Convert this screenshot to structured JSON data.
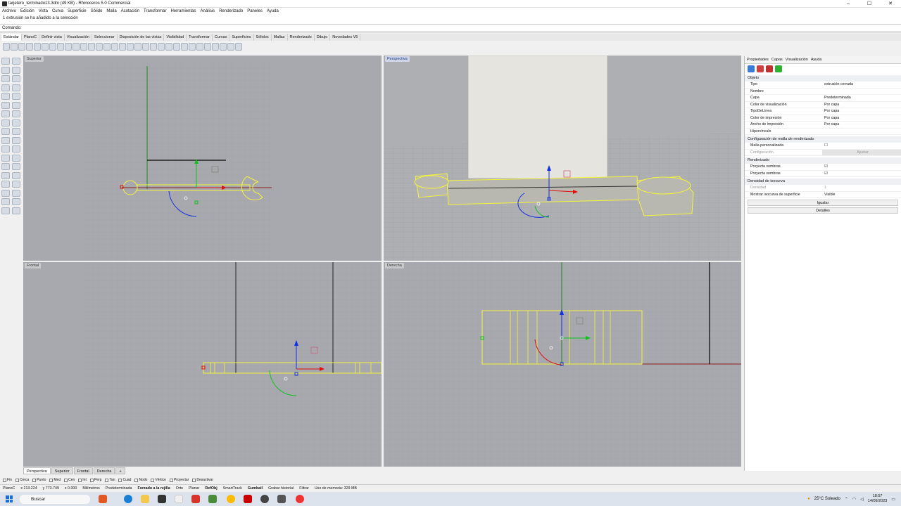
{
  "window": {
    "title": "tarjetero_terminado13.3dm (49 KB) - Rhinoceros 5.0 Commercial",
    "buttons": [
      "–",
      "☐",
      "✕"
    ]
  },
  "menu": [
    "Archivo",
    "Edición",
    "Vista",
    "Curva",
    "Superficie",
    "Sólido",
    "Malla",
    "Acotación",
    "Transformar",
    "Herramientas",
    "Análisis",
    "Renderizado",
    "Paneles",
    "Ayuda"
  ],
  "history": "1 extrusión se ha añadido a la selección",
  "command": {
    "label": "Comando:"
  },
  "tabs": [
    {
      "label": "Estándar",
      "active": true
    },
    {
      "label": "PlanoC"
    },
    {
      "label": "Definir vista"
    },
    {
      "label": "Visualización"
    },
    {
      "label": "Seleccionar"
    },
    {
      "label": "Disposición de las vistas"
    },
    {
      "label": "Visibilidad"
    },
    {
      "label": "Transformar"
    },
    {
      "label": "Curvas"
    },
    {
      "label": "Superficies"
    },
    {
      "label": "Sólidos"
    },
    {
      "label": "Mallas"
    },
    {
      "label": "Renderizado"
    },
    {
      "label": "Dibujo"
    },
    {
      "label": "Novedades V5"
    }
  ],
  "viewports": {
    "top": {
      "label": "Superior"
    },
    "perspective": {
      "label": "Perspectiva"
    },
    "front": {
      "label": "Frontal"
    },
    "right": {
      "label": "Derecha"
    }
  },
  "panel": {
    "tabs": [
      "Propiedades",
      "Capas",
      "Visualización",
      "Ayuda"
    ],
    "object_section": "Objeto",
    "object_rows": [
      {
        "k": "Tipo",
        "v": "extrusión cerrada"
      },
      {
        "k": "Nombre",
        "v": ""
      },
      {
        "k": "Capa",
        "v": "Predeterminada"
      },
      {
        "k": "Color de visualización",
        "v": "Por capa"
      },
      {
        "k": "TipoDeLínea",
        "v": "Por capa"
      },
      {
        "k": "Color de impresión",
        "v": "Por capa"
      },
      {
        "k": "Ancho de impresión",
        "v": "Por capa"
      },
      {
        "k": "Hipervínculo",
        "v": ""
      }
    ],
    "mesh_section": "Configuración de malla de renderizado",
    "mesh_rows": [
      {
        "k": "Malla personalizada",
        "v": ""
      },
      {
        "k": "Configuración",
        "v": "Ajustar"
      }
    ],
    "render_section": "Renderizado",
    "render_rows": [
      {
        "k": "Proyecta sombras",
        "v": ""
      },
      {
        "k": "Proyecta sombras",
        "v": ""
      }
    ],
    "iso_section": "Densidad de isocurva",
    "iso_rows": [
      {
        "k": "Densidad",
        "v": "1"
      },
      {
        "k": "Mostrar isocurva de superficie",
        "v": "Visible"
      }
    ],
    "buttons": [
      "Igualar",
      "Detalles"
    ]
  },
  "viewport_tabs": [
    {
      "label": "Perspectiva",
      "active": true
    },
    {
      "label": "Superior"
    },
    {
      "label": "Frontal"
    },
    {
      "label": "Derecha"
    },
    {
      "label": "+"
    }
  ],
  "osnaps": [
    "Fin",
    "Cerca",
    "Punto",
    "Med",
    "Cen",
    "Int",
    "Perp",
    "Tan",
    "Cuad",
    "Nodo",
    "Vértice",
    "Proyectar",
    "Desactivar"
  ],
  "status": {
    "cplane": "PlanoC",
    "x": "x 213.224",
    "y": "y 773.749",
    "z": "z 0.000",
    "units": "Milímetros",
    "layer": "Predeterminada",
    "items": [
      "Forzado a la rejilla",
      "Orto",
      "Planar",
      "RefObj",
      "SmartTrack",
      "Gumball",
      "Grabar historial",
      "Filtrar",
      "Uso de memoria: 329 MB"
    ]
  },
  "taskbar": {
    "search": "Buscar",
    "weather": "25°C Soleado",
    "time": "18:57",
    "date": "14/09/2023"
  },
  "colors": {
    "viewport_bg": "#a8a9ae",
    "selection": "#f5f53a",
    "x_axis": "#e01010",
    "y_axis": "#10c020",
    "z_axis": "#1030e0"
  }
}
